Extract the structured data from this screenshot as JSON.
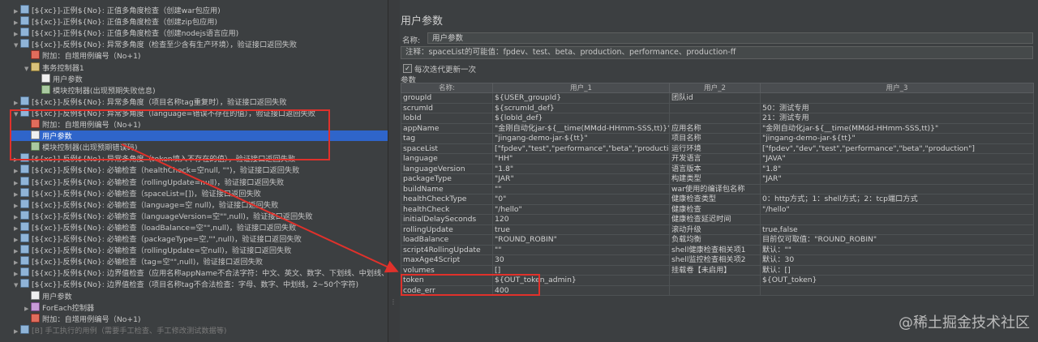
{
  "tree": [
    {
      "indent": 1,
      "arrow": "▶",
      "icon": "ic-tg",
      "text": "[${xc}]-正例${No}: 正值多角度检查（创建war包应用)"
    },
    {
      "indent": 1,
      "arrow": "▶",
      "icon": "ic-tg",
      "text": "[${xc}]-正例${No}: 正值多角度检查（创建zip包应用)"
    },
    {
      "indent": 1,
      "arrow": "▶",
      "icon": "ic-tg",
      "text": "[${xc}]-正例${No}: 正值多角度检查（创建nodejs语言应用)"
    },
    {
      "indent": 1,
      "arrow": "▼",
      "icon": "ic-tg",
      "text": "[${xc}]-反例${No}: 异常多角度（检查至少含有生产环境），验证接口返回失败"
    },
    {
      "indent": 2,
      "arrow": "",
      "icon": "ic-pre",
      "text": "附加：自增用例编号（No+1)"
    },
    {
      "indent": 2,
      "arrow": "▼",
      "icon": "ic-ctl",
      "text": "事务控制器1"
    },
    {
      "indent": 3,
      "arrow": "",
      "icon": "ic-cfg",
      "text": "用户参数"
    },
    {
      "indent": 3,
      "arrow": "",
      "icon": "ic-mod",
      "text": "模块控制器(出现预期失败信息)"
    },
    {
      "indent": 1,
      "arrow": "▶",
      "icon": "ic-tg",
      "text": "[${xc}]-反例${No}: 异常多角度（项目名称tag重复时），验证接口返回失败"
    },
    {
      "indent": 1,
      "arrow": "▼",
      "icon": "ic-tg",
      "text": "[${xc}]-反例${No}: 异常多角度（language=错误不存在的值），验证接口返回失败"
    },
    {
      "indent": 2,
      "arrow": "",
      "icon": "ic-pre",
      "text": "附加：自增用例编号（No+1)"
    },
    {
      "indent": 2,
      "arrow": "",
      "icon": "ic-cfg",
      "text": "用户参数",
      "selected": true
    },
    {
      "indent": 2,
      "arrow": "",
      "icon": "ic-mod",
      "text": "模块控制器(出现预期错误码)"
    },
    {
      "indent": 1,
      "arrow": "▶",
      "icon": "ic-tg",
      "text": "[${xc}]-反例${No}: 异常多角度（token填入不存在的值），验证接口返回失败"
    },
    {
      "indent": 1,
      "arrow": "▶",
      "icon": "ic-tg",
      "text": "[${xc}]-反例${No}: 必输检查（healthCheck=空null, \"\")，验证接口返回失败"
    },
    {
      "indent": 1,
      "arrow": "▶",
      "icon": "ic-tg",
      "text": "[${xc}]-反例${No}: 必输检查（rollingUpdate=null)，验证接口返回失败"
    },
    {
      "indent": 1,
      "arrow": "▶",
      "icon": "ic-tg",
      "text": "[${xc}]-反例${No}: 必输检查（spaceList=[])，验证接口返回失败"
    },
    {
      "indent": 1,
      "arrow": "▶",
      "icon": "ic-tg",
      "text": "[${xc}]-反例${No}: 必输检查（language=空 null)，验证接口返回失败"
    },
    {
      "indent": 1,
      "arrow": "▶",
      "icon": "ic-tg",
      "text": "[${xc}]-反例${No}: 必输检查（languageVersion=空\"\",null)，验证接口返回失败"
    },
    {
      "indent": 1,
      "arrow": "▶",
      "icon": "ic-tg",
      "text": "[${xc}]-反例${No}: 必输检查（loadBalance=空\"\",null)，验证接口返回失败"
    },
    {
      "indent": 1,
      "arrow": "▶",
      "icon": "ic-tg",
      "text": "[${xc}]-反例${No}: 必输检查（packageType=空,\"\",null)，验证接口返回失败"
    },
    {
      "indent": 1,
      "arrow": "▶",
      "icon": "ic-tg",
      "text": "[${xc}]-反例${No}: 必输检查（rollingUpdate=空null)，验证接口返回失败"
    },
    {
      "indent": 1,
      "arrow": "▶",
      "icon": "ic-tg",
      "text": "[${xc}]-反例${No}: 必输检查（tag=空\"\",null)，验证接口返回失败"
    },
    {
      "indent": 1,
      "arrow": "▶",
      "icon": "ic-tg",
      "text": "[${xc}]-反例${No}: 边界值检查（应用名称appName不合法字符：中文、英文、数字、下划线、中划线、."
    },
    {
      "indent": 1,
      "arrow": "▼",
      "icon": "ic-tg",
      "text": "[${xc}]-反例${No}: 边界值检查（项目名称tag不合法检查：字母、数字、中划线，2~50个字符)"
    },
    {
      "indent": 2,
      "arrow": "",
      "icon": "ic-cfg",
      "text": "用户参数"
    },
    {
      "indent": 2,
      "arrow": "▶",
      "icon": "ic-fe",
      "text": "ForEach控制器"
    },
    {
      "indent": 2,
      "arrow": "",
      "icon": "ic-pre",
      "text": "附加：自增用例编号（No+1)"
    },
    {
      "indent": 1,
      "arrow": "▶",
      "icon": "ic-tg",
      "text": "[B] 手工执行的用例（需要手工检查、手工修改测试数据等)",
      "dim": true
    }
  ],
  "panel": {
    "title": "用户参数",
    "name_label": "名称:",
    "name_value": "用户参数",
    "note": "注释：spaceList的可能值：fpdev、test、beta、production、performance、production-ff",
    "checkbox_checked": true,
    "checkbox_label": "每次迭代更新一次",
    "params_label": "参数",
    "columns": [
      "名称:",
      "用户_1",
      "用户_2",
      "用户_3"
    ],
    "rows": [
      [
        "groupId",
        "${USER_groupId}",
        "团队id",
        ""
      ],
      [
        "scrumId",
        "${scrumId_def}",
        "",
        "50：测试专用"
      ],
      [
        "lobId",
        "${lobId_def}",
        "",
        "21：测试专用"
      ],
      [
        "appName",
        "\"金刚自动化jar-${__time(MMdd-HHmm-SSS,tt)}\"",
        "应用名称",
        "\"金刚自动化jar-${__time(MMdd-HHmm-SSS,tt)}\""
      ],
      [
        "tag",
        "\"jingang-demo-jar-${tt}\"",
        "项目名称",
        "\"jingang-demo-jar-${tt}\""
      ],
      [
        "spaceList",
        "[\"fpdev\",\"test\",\"performance\",\"beta\",\"production\"]",
        "运行环境",
        "[\"fpdev\",\"dev\",\"test\",\"performance\",\"beta\",\"production\"]"
      ],
      [
        "language",
        "\"HH\"",
        "开发语言",
        "\"JAVA\""
      ],
      [
        "languageVersion",
        "\"1.8\"",
        "语言版本",
        "\"1.8\""
      ],
      [
        "packageType",
        "\"JAR\"",
        "构建类型",
        "\"JAR\""
      ],
      [
        "buildName",
        "\"\"",
        "war使用的编译包名称",
        ""
      ],
      [
        "healthCheckType",
        "\"0\"",
        "健康检查类型",
        "0：http方式；1：shell方式；2：tcp端口方式"
      ],
      [
        "healthCheck",
        "\"/hello\"",
        "健康检查",
        "\"/hello\""
      ],
      [
        "initialDelaySeconds",
        "120",
        "健康检查延迟时间",
        ""
      ],
      [
        "rollingUpdate",
        "true",
        "滚动升级",
        "true,false"
      ],
      [
        "loadBalance",
        "\"ROUND_ROBIN\"",
        "负载均衡",
        "目前仅可取值：\"ROUND_ROBIN\""
      ],
      [
        "script4RollingUpdate",
        "\"\"",
        "shell健康检查相关项1",
        "默认：\"\""
      ],
      [
        "maxAge4Script",
        "30",
        "shell监控检查相关项2",
        "默认：30"
      ],
      [
        "volumes",
        "[]",
        "挂载卷【未启用】",
        "默认：[]"
      ],
      [
        "token",
        "${OUT_token_admin}",
        "",
        "${OUT_token}"
      ],
      [
        "code_err",
        "400",
        "",
        ""
      ]
    ]
  },
  "watermark": "@稀土掘金技术社区",
  "colors": {
    "annotation_red": "#e0312b",
    "selection": "#2f65ca"
  }
}
